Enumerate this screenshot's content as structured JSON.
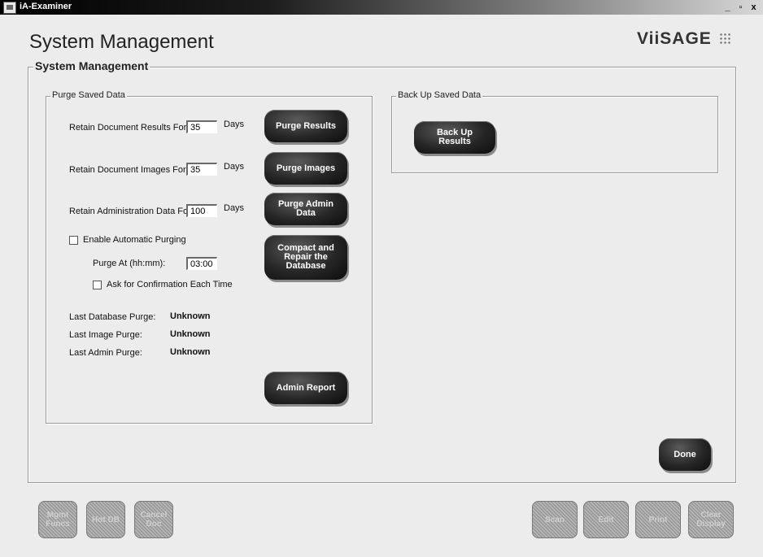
{
  "window": {
    "title": "iA-Examiner",
    "controls": [
      "_",
      "▫",
      "x"
    ]
  },
  "header": {
    "title": "System Management",
    "brand": "ViiSAGE"
  },
  "main_group": {
    "legend": "System Management"
  },
  "purge": {
    "legend": "Purge Saved Data",
    "results_label": "Retain Document Results For:",
    "results_value": "35",
    "images_label": "Retain Document Images For:",
    "images_value": "35",
    "admin_label": "Retain Administration Data For:",
    "admin_value": "100",
    "days_unit": "Days",
    "auto_purge_label": "Enable Automatic Purging",
    "purge_at_label": "Purge At (hh:mm):",
    "purge_at_value": "03:00",
    "confirm_label": "Ask for Confirmation Each Time",
    "last_db_label": "Last Database Purge:",
    "last_db_value": "Unknown",
    "last_image_label": "Last Image Purge:",
    "last_image_value": "Unknown",
    "last_admin_label": "Last Admin Purge:",
    "last_admin_value": "Unknown",
    "btn_purge_results": "Purge Results",
    "btn_purge_images": "Purge Images",
    "btn_purge_admin": "Purge Admin\nData",
    "btn_compact": "Compact and\nRepair the\nDatabase",
    "btn_admin_report": "Admin Report"
  },
  "backup": {
    "legend": "Back Up Saved Data",
    "btn_backup": "Back Up\nResults"
  },
  "done_label": "Done",
  "footer": {
    "mgmt": "Mgmt\nFuncs",
    "hot_db": "Hot DB",
    "cancel_doc": "Cancel\nDoc",
    "scan": "Scan",
    "edit": "Edit",
    "print": "Print",
    "clear": "Clear\nDisplay"
  }
}
